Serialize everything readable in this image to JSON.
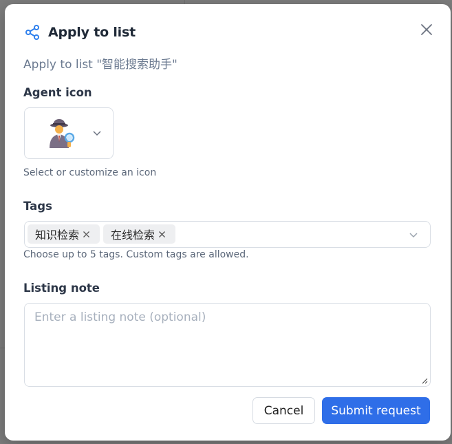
{
  "dialog": {
    "title": "Apply to list",
    "subtitle": "Apply to list \"智能搜索助手\"",
    "close_label": "Close"
  },
  "agent_icon": {
    "label": "Agent icon",
    "selected_emoji": "detective",
    "help": "Select or customize an icon"
  },
  "tags": {
    "label": "Tags",
    "items": [
      {
        "text": "知识检索"
      },
      {
        "text": "在线检索"
      }
    ],
    "help": "Choose up to 5 tags. Custom tags are allowed."
  },
  "listing_note": {
    "label": "Listing note",
    "value": "",
    "placeholder": "Enter a listing note (optional)"
  },
  "actions": {
    "cancel": "Cancel",
    "submit": "Submit request"
  },
  "colors": {
    "accent": "#2f6ee8",
    "share_icon": "#2f80ed",
    "overlay": "#8a8a8a"
  }
}
